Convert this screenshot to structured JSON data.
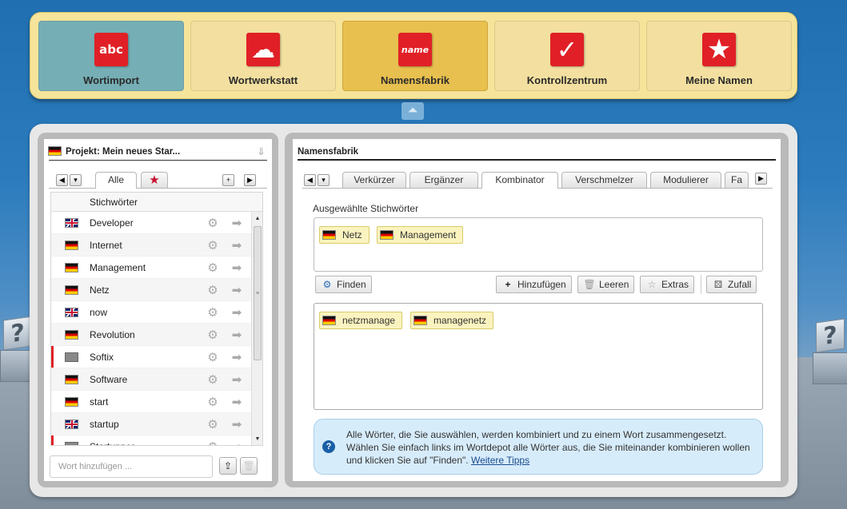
{
  "nav": {
    "tiles": [
      {
        "label": "Wortimport",
        "icon": "abc-icon",
        "glyph": "abc"
      },
      {
        "label": "Wortwerkstatt",
        "icon": "cloud-icon",
        "glyph": "☁"
      },
      {
        "label": "Namensfabrik",
        "icon": "factory-icon",
        "glyph": "name"
      },
      {
        "label": "Kontrollzentrum",
        "icon": "checkmark-icon",
        "glyph": "✓"
      },
      {
        "label": "Meine Namen",
        "icon": "star-icon",
        "glyph": "★"
      }
    ],
    "active_index": 2,
    "collapse_glyph": "⏶"
  },
  "left": {
    "project_title": "Projekt: Mein neues Star...",
    "tab_all": "Alle",
    "tab_fav_glyph": "★",
    "column_header": "Stichwörter",
    "keywords": [
      {
        "word": "Developer",
        "flag": "uk",
        "marked": false
      },
      {
        "word": "Internet",
        "flag": "de",
        "marked": false
      },
      {
        "word": "Management",
        "flag": "de",
        "marked": false
      },
      {
        "word": "Netz",
        "flag": "de",
        "marked": false
      },
      {
        "word": "now",
        "flag": "uk",
        "marked": false
      },
      {
        "word": "Revolution",
        "flag": "de",
        "marked": false
      },
      {
        "word": "Softix",
        "flag": "none",
        "marked": true
      },
      {
        "word": "Software",
        "flag": "de",
        "marked": false
      },
      {
        "word": "start",
        "flag": "de",
        "marked": false
      },
      {
        "word": "startup",
        "flag": "uk",
        "marked": false
      },
      {
        "word": "Startupper",
        "flag": "none",
        "marked": true
      }
    ],
    "add_placeholder": "Wort hinzufügen ..."
  },
  "right": {
    "title": "Namensfabrik",
    "tabs": [
      "Verkürzer",
      "Ergänzer",
      "Kombinator",
      "Verschmelzer",
      "Modulierer",
      "Fa"
    ],
    "active_tab": "Kombinator",
    "selected_label": "Ausgewählte Stichwörter",
    "selected": [
      "Netz",
      "Management"
    ],
    "buttons": {
      "find": "Finden",
      "add": "Hinzufügen",
      "clear": "Leeren",
      "extras": "Extras",
      "random": "Zufall"
    },
    "results": [
      "netzmanage",
      "managenetz"
    ],
    "tip_text": "Alle Wörter, die Sie auswählen, werden kombiniert und zu einem Wort zusammengesetzt. Wählen Sie einfach links im Wortdepot alle Wörter aus, die Sie miteinander kombinieren wollen und klicken Sie auf \"Finden\".",
    "tip_link": "Weitere Tipps"
  },
  "colors": {
    "accent_red": "#e02026",
    "active_tile": "#e8c04f",
    "first_tile": "#76aeb5",
    "chip_bg": "#fbf3bf",
    "tip_bg": "#d7ecfb"
  }
}
